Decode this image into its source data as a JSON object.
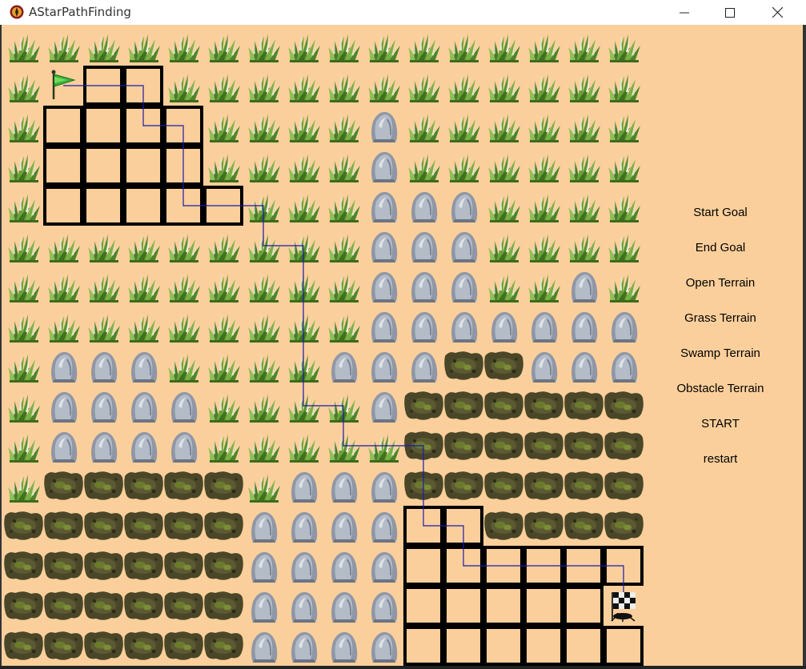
{
  "window": {
    "title": "AStarPathFinding",
    "controls": {
      "minimize": "minimize-icon",
      "maximize": "maximize-icon",
      "close": "close-icon"
    }
  },
  "colors": {
    "background": "#FBCF9B",
    "path": "#1a1aaa",
    "open_border": "#000000",
    "swamp": "#4a4628",
    "rock": "#8f97a6"
  },
  "legend": {
    "G": "grass",
    "R": "rock",
    "W": "swamp",
    "O": "open",
    "S": "start-flag",
    "E": "end-flag"
  },
  "grid": {
    "rows": 16,
    "cols": 16,
    "cells": [
      "GGGGGGGGGGGGGGGG",
      "GSOOGGGGGGGGGGGG",
      "GOOOOGGGGRGGGGGG",
      "GOOOOGGGGRGGGGGG",
      "GOOOOOGGGRRRGGGG",
      "GGGGGGGGGRRRGGGG",
      "GGGGGGGGGRRRGGRG",
      "GGGGGGGGGRRRRRRR",
      "GRRRGGGGRRRWWRRR",
      "GRRRRGGGGRWWWWWW",
      "GRRRRGGGGGWWWWWW",
      "GWWWWWGRRRWWWWWW",
      "WWWWWWRRRROOWWWW",
      "WWWWWWRRRROOOOOO",
      "WWWWWWRRRROOOOOE",
      "WWWWWWRRRROOOOOO"
    ]
  },
  "path": [
    [
      1,
      1
    ],
    [
      1,
      2
    ],
    [
      1,
      3
    ],
    [
      2,
      3
    ],
    [
      2,
      4
    ],
    [
      3,
      4
    ],
    [
      4,
      4
    ],
    [
      4,
      5
    ],
    [
      4,
      6
    ],
    [
      5,
      6
    ],
    [
      5,
      7
    ],
    [
      6,
      7
    ],
    [
      7,
      7
    ],
    [
      8,
      7
    ],
    [
      9,
      7
    ],
    [
      9,
      8
    ],
    [
      10,
      8
    ],
    [
      10,
      9
    ],
    [
      10,
      10
    ],
    [
      11,
      10
    ],
    [
      12,
      10
    ],
    [
      12,
      11
    ],
    [
      13,
      11
    ],
    [
      13,
      12
    ],
    [
      13,
      13
    ],
    [
      13,
      14
    ],
    [
      13,
      15
    ],
    [
      14,
      15
    ]
  ],
  "controls_panel": {
    "buttons": [
      {
        "id": "start-goal",
        "label": "Start Goal"
      },
      {
        "id": "end-goal",
        "label": "End Goal"
      },
      {
        "id": "open-terrain",
        "label": "Open Terrain"
      },
      {
        "id": "grass-terrain",
        "label": "Grass Terrain"
      },
      {
        "id": "swamp-terrain",
        "label": "Swamp Terrain"
      },
      {
        "id": "obstacle-terrain",
        "label": "Obstacle Terrain"
      },
      {
        "id": "start",
        "label": "START"
      },
      {
        "id": "restart",
        "label": "restart"
      }
    ]
  }
}
